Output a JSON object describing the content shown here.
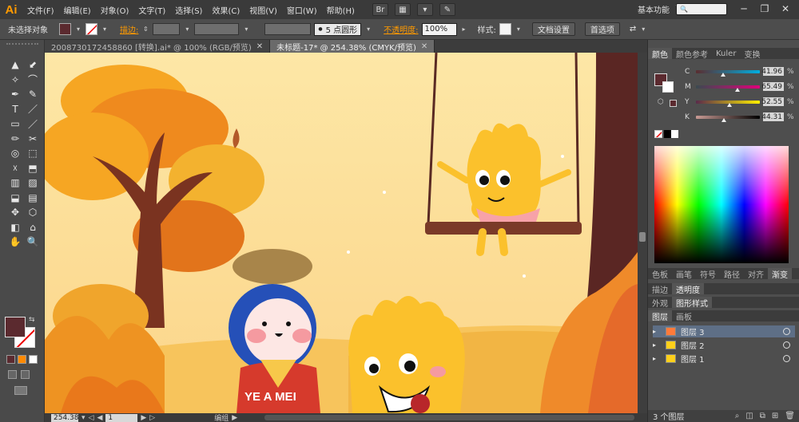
{
  "app": {
    "logo": "Ai",
    "accent": "#ff9a00"
  },
  "menu": [
    "文件(F)",
    "编辑(E)",
    "对象(O)",
    "文字(T)",
    "选择(S)",
    "效果(C)",
    "视图(V)",
    "窗口(W)",
    "帮助(H)"
  ],
  "menubar_tools": {
    "br": "Br",
    "layout": "▦",
    "arrow": "▾",
    "brush": "✎"
  },
  "workspace": {
    "label": "基本功能",
    "arrow": "▾"
  },
  "search": {
    "icon": "🔍"
  },
  "window": {
    "minimize": "─",
    "restore": "❐",
    "close": "✕"
  },
  "control": {
    "selection": "未选择对象",
    "stroke_label": "描边:",
    "brush": "5 点圆形",
    "brush_dot": "●",
    "opacity_label": "不透明度:",
    "opacity_value": "100%",
    "style_label": "样式:",
    "doc_setup": "文档设置",
    "preferences": "首选项",
    "arrange_icon": "⇄",
    "dd": "▾",
    "spin": "⇕"
  },
  "colors": {
    "fill": "#5b2a2f",
    "stroke": "#ffffff",
    "canvas_bg": "#fbe6a8"
  },
  "tools": [
    "▲",
    "⬋",
    "✧",
    "⌒",
    "✒",
    "✎",
    "T",
    "／",
    "▭",
    "／",
    "✏",
    "✂",
    "◎",
    "⬚",
    "☓",
    "⬒",
    "▥",
    "▨",
    "⬓",
    "▤",
    "✥",
    "⬡",
    "◧",
    "⌂",
    "✋",
    "🔍"
  ],
  "tabs": [
    {
      "label": "20087301724588​60 [转换].ai* @ 100% (RGB/预览)",
      "active": false,
      "close": "✕"
    },
    {
      "label": "未标题-17* @ 254.38% (CMYK/预览)",
      "active": true,
      "close": "✕"
    }
  ],
  "artwork": {
    "shirt_text": "YE A MEI"
  },
  "statusbar": {
    "zoom": "254.38",
    "page": "1",
    "mode": "编组",
    "arrow": "▾",
    "nav_prev": "◀",
    "nav_next": "▶",
    "nav_first": "◁",
    "nav_last": "▷"
  },
  "panels": {
    "color_tabs": [
      "颜色",
      "颜色参考",
      "Kuler",
      "变换"
    ],
    "cmyk": [
      {
        "label": "C",
        "value": "41.96",
        "pct": "%",
        "fraction": 0.42,
        "gradient": "linear-gradient(to right,#5a2d30,#00aee0)"
      },
      {
        "label": "M",
        "value": "65.49",
        "pct": "%",
        "fraction": 0.65,
        "gradient": "linear-gradient(to right,#3a4a50,#e0007a)"
      },
      {
        "label": "Y",
        "value": "52.55",
        "pct": "%",
        "fraction": 0.53,
        "gradient": "linear-gradient(to right,#5a2a4a,#fff000)"
      },
      {
        "label": "K",
        "value": "44.31",
        "pct": "%",
        "fraction": 0.44,
        "gradient": "linear-gradient(to right,#c89a94,#000000)"
      }
    ],
    "swatch_tabs": [
      "色板",
      "画笔",
      "符号",
      "路径",
      "对齐",
      "渐变"
    ],
    "stroke_tabs": [
      "描边",
      "透明度"
    ],
    "appearance_tabs": [
      "外观",
      "图形样式"
    ],
    "layer_tabs": [
      "图层",
      "画板"
    ],
    "layers": [
      {
        "name": "图层 3",
        "color": "#ff7a3a",
        "selected": true
      },
      {
        "name": "图层 2",
        "color": "#ffd01a",
        "selected": false
      },
      {
        "name": "图层 1",
        "color": "#ffd01a",
        "selected": false
      }
    ],
    "layer_count": "3 个图层"
  }
}
